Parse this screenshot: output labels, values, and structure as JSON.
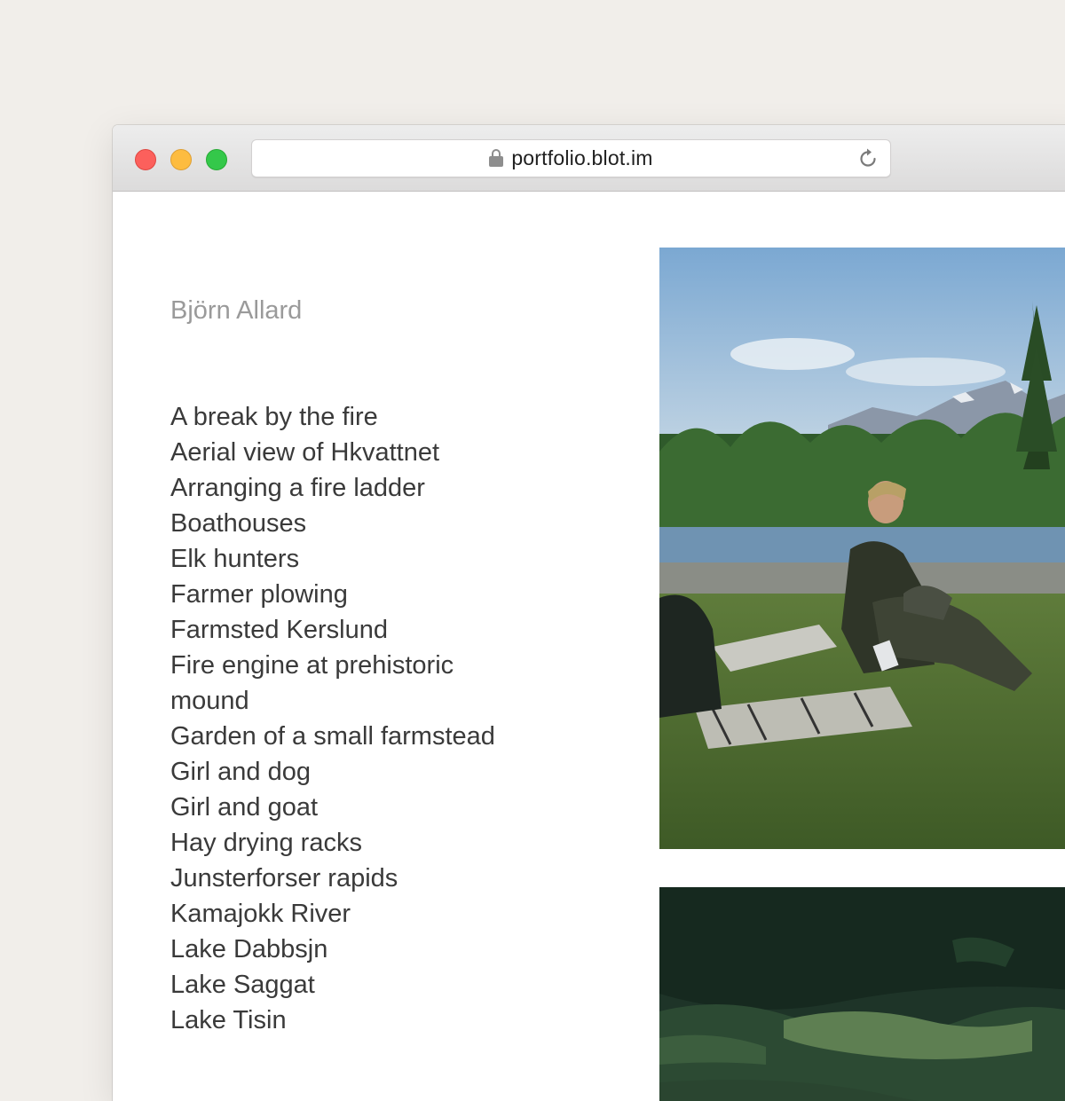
{
  "browser": {
    "url": "portfolio.blot.im",
    "lock_icon": "lock-icon",
    "reload_icon": "reload-icon",
    "traffic_lights": {
      "close_color": "#fc605c",
      "minimize_color": "#fdbc40",
      "maximize_color": "#34c84a"
    }
  },
  "site": {
    "author": "Björn Allard",
    "photos": [
      "A break by the fire",
      "Aerial view of Hkvattnet",
      "Arranging a fire ladder",
      "Boathouses",
      "Elk hunters",
      "Farmer plowing",
      "Farmsted Kerslund",
      "Fire engine at prehistoric mound",
      "Garden of a small farmstead",
      "Girl and dog",
      "Girl and goat",
      "Hay drying racks",
      "Junsterforser rapids",
      "Kamajokk River",
      "Lake Dabbsjn",
      "Lake Saggat",
      "Lake Tisin"
    ]
  },
  "colors": {
    "page_background": "#f1eeea",
    "author_text": "#9a9a9a",
    "list_text": "#3a3a3a"
  }
}
